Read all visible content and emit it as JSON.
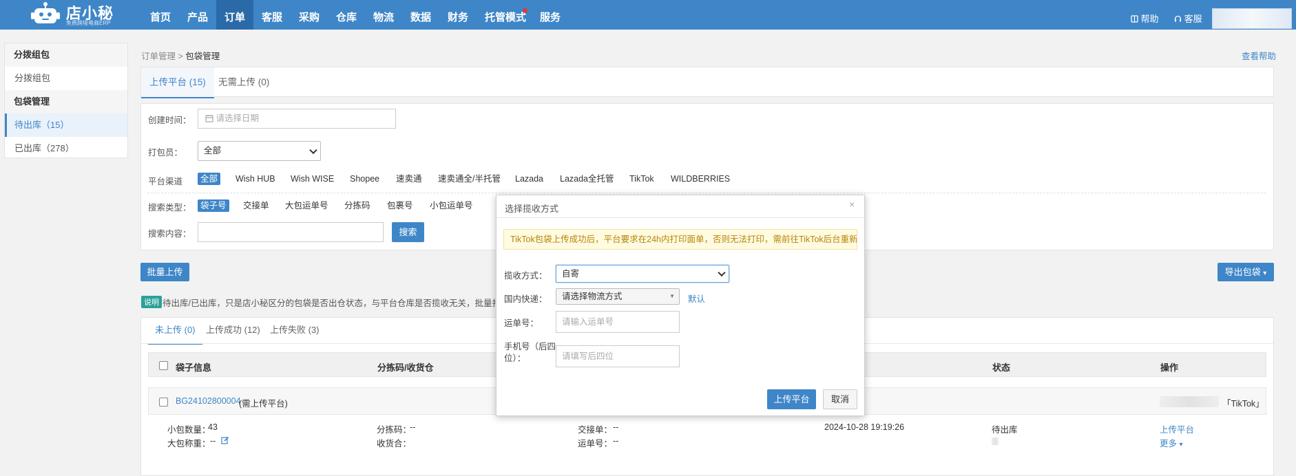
{
  "header": {
    "logo_text": "店小秘",
    "logo_sub": "免费跨境电商ERP",
    "nav": [
      "首页",
      "产品",
      "订单",
      "客服",
      "采购",
      "仓库",
      "物流",
      "数据",
      "财务",
      "托管模式",
      "服务"
    ],
    "help": "帮助",
    "service": "客服"
  },
  "sidebar": {
    "section1_title": "分拨组包",
    "section1_item": "分拨组包",
    "section2_title": "包袋管理",
    "item_pending": "待出库（15）",
    "item_shipped": "已出库（278）"
  },
  "breadcrumb": {
    "parent": "订单管理",
    "current": "包袋管理"
  },
  "help_link": "查看帮助",
  "tabs": [
    "上传平台 (15)",
    "无需上传 (0)"
  ],
  "filters": {
    "created_label": "创建时间：",
    "created_placeholder": "请选择日期",
    "packer_label": "打包员：",
    "packer_value": "全部",
    "channel_label": "平台渠道",
    "channels": [
      "全部",
      "Wish HUB",
      "Wish WISE",
      "Shopee",
      "速卖通",
      "速卖通全/半托管",
      "Lazada",
      "Lazada全托管",
      "TikTok",
      "WILDBERRIES"
    ],
    "search_type_label": "搜索类型：",
    "search_types": [
      "袋子号",
      "交接单",
      "大包运单号",
      "分拣码",
      "包裹号",
      "小包运单号"
    ],
    "search_content_label": "搜索内容：",
    "search_button": "搜索"
  },
  "actions": {
    "batch_upload": "批量上传",
    "export": "导出包袋"
  },
  "note": {
    "tag": "说明",
    "text": "待出库/已出库，只是店小秘区分的包袋是否出仓状态，与平台仓库是否揽收无关，批量打印面"
  },
  "subtabs": [
    "未上传 (0)",
    "上传成功 (12)",
    "上传失败 (3)"
  ],
  "table": {
    "headers": [
      "袋子信息",
      "分拣码/收货仓",
      "状态",
      "操作"
    ],
    "row": {
      "bag_id": "BG24102800004",
      "bag_note": "(需上传平台)",
      "platform": "「TikTok」",
      "small_count_label": "小包数量：",
      "small_count": "43",
      "weight_label": "大包称重：",
      "weight": "--",
      "sort_code_label": "分拣码：",
      "sort_code": "--",
      "warehouse_label": "收货合：",
      "handover_label": "交接单：",
      "handover": "--",
      "waybill_label": "运单号：",
      "waybill": "--",
      "time": "2024-10-28 19:19:26",
      "status": "待出库",
      "action_upload": "上传平台",
      "action_more": "更多"
    }
  },
  "modal": {
    "title": "选择揽收方式",
    "warning": "TikTok包袋上传成功后，平台要求在24h内打印面单，否则无法打印，需前往TikTok后台重新组包",
    "pickup_label": "揽收方式：",
    "pickup_value": "自寄",
    "express_label": "国内快递：",
    "express_value": "请选择物流方式",
    "default_link": "默认",
    "waybill_label": "运单号：",
    "waybill_placeholder": "请输入运单号",
    "phone_label_1": "手机号（后四",
    "phone_label_2": "位）：",
    "phone_placeholder": "请填写后四位",
    "confirm": "上传平台",
    "cancel": "取消"
  },
  "colors": {
    "primary": "#3e86c8",
    "nav_active": "#2b6aa8",
    "warning_bg": "#fffbe0",
    "warning_text": "#b8830a",
    "note_tag": "#2aa198"
  }
}
